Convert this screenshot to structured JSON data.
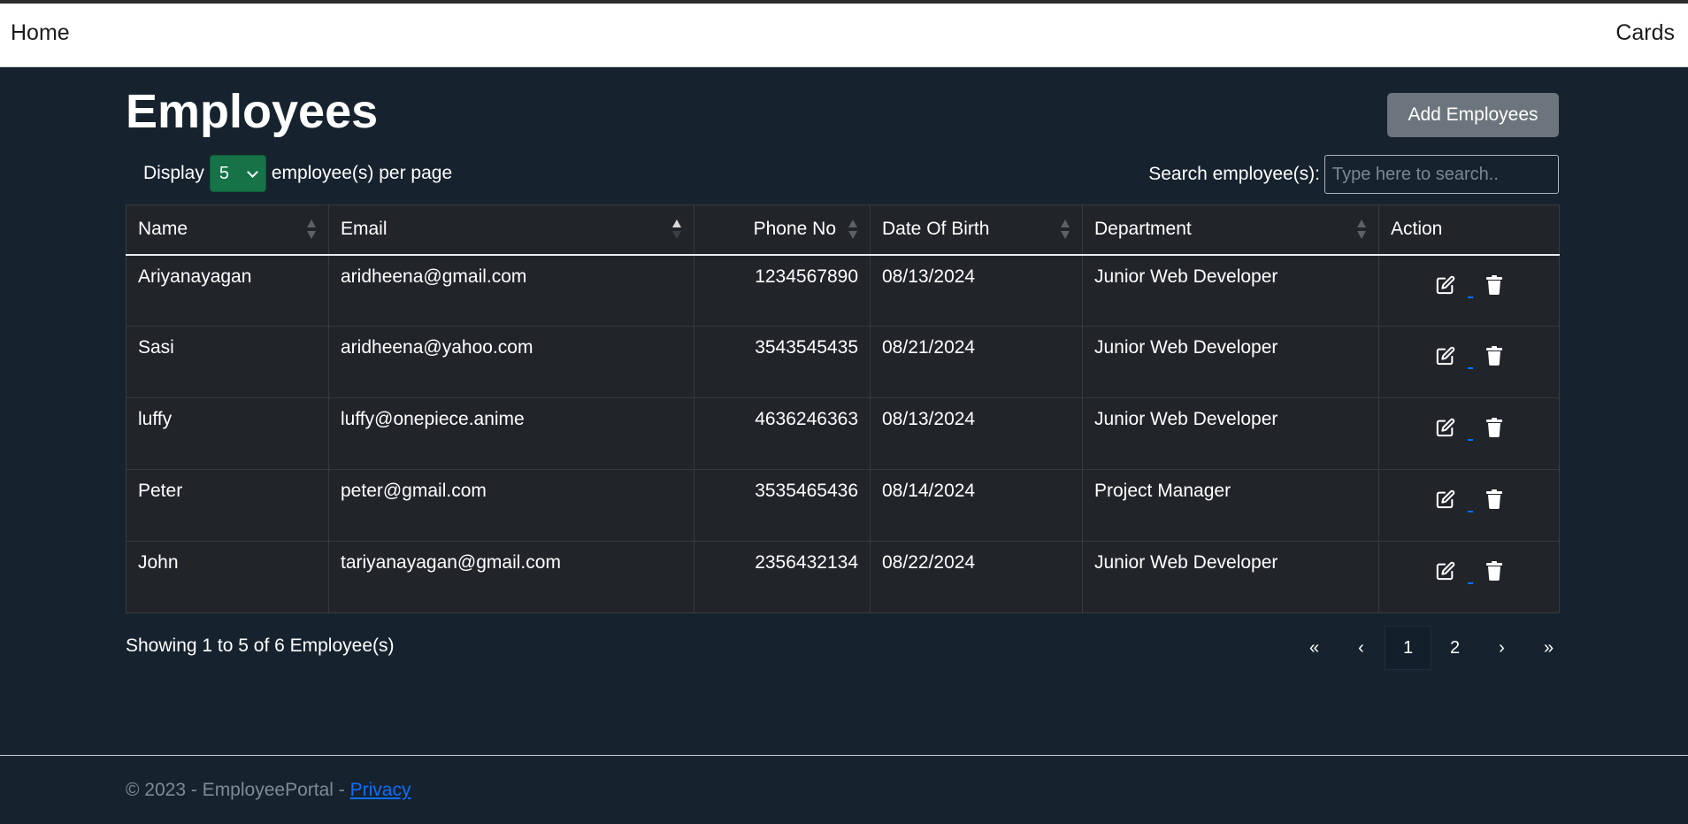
{
  "nav": {
    "home": "Home",
    "cards": "Cards"
  },
  "page": {
    "title": "Employees",
    "add_button": "Add Employees"
  },
  "controls": {
    "display_label": "Display",
    "per_page_value": "5",
    "per_page_suffix": "employee(s) per page",
    "search_label": "Search employee(s):",
    "search_placeholder": "Type here to search.."
  },
  "table": {
    "columns": [
      "Name",
      "Email",
      "Phone No",
      "Date Of Birth",
      "Department",
      "Action"
    ],
    "sorted_column": "Email",
    "sort_direction": "asc",
    "rows": [
      {
        "name": "Ariyanayagan",
        "email": "aridheena@gmail.com",
        "phone": "1234567890",
        "dob": "08/13/2024",
        "department": "Junior Web Developer"
      },
      {
        "name": "Sasi",
        "email": "aridheena@yahoo.com",
        "phone": "3543545435",
        "dob": "08/21/2024",
        "department": "Junior Web Developer"
      },
      {
        "name": "luffy",
        "email": "luffy@onepiece.anime",
        "phone": "4636246363",
        "dob": "08/13/2024",
        "department": "Junior Web Developer"
      },
      {
        "name": "Peter",
        "email": "peter@gmail.com",
        "phone": "3535465436",
        "dob": "08/14/2024",
        "department": "Project Manager"
      },
      {
        "name": "John",
        "email": "tariyanayagan@gmail.com",
        "phone": "2356432134",
        "dob": "08/22/2024",
        "department": "Junior Web Developer"
      }
    ],
    "action_icons": [
      "edit-icon",
      "trash-icon"
    ]
  },
  "pagination": {
    "summary": "Showing 1 to 5 of 6 Employee(s)",
    "first": "«",
    "prev": "‹",
    "pages": [
      "1",
      "2"
    ],
    "active_page": "1",
    "next": "›",
    "last": "»"
  },
  "footer": {
    "copyright": "© 2023 - EmployeePortal - ",
    "privacy": "Privacy"
  },
  "colors": {
    "background": "#16232f",
    "table_bg": "#212529",
    "select_bg": "#157347",
    "button_bg": "#6c757d",
    "link": "#0d6efd"
  }
}
